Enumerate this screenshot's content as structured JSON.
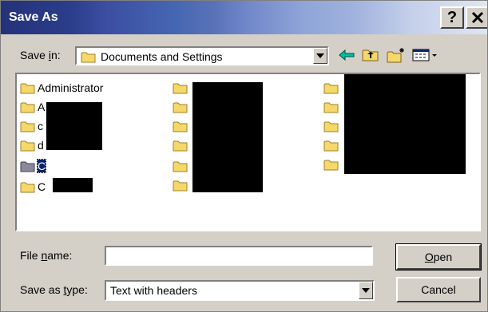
{
  "window": {
    "title": "Save As",
    "help_label": "?",
    "close_label": "✕"
  },
  "toolbar": {
    "save_in_prefix": "Save ",
    "save_in_underline": "i",
    "save_in_suffix": "n:",
    "location": "Documents and Settings",
    "tools": [
      "back-arrow-icon",
      "up-one-level-icon",
      "new-folder-icon",
      "view-menu-icon"
    ]
  },
  "files": {
    "items": [
      {
        "label": "Administrator"
      },
      {
        "label": "A"
      },
      {
        "label": "c"
      },
      {
        "label": "d"
      },
      {
        "label": "C"
      },
      {
        "label": "C"
      }
    ]
  },
  "file_name": {
    "prefix": "File ",
    "underline": "n",
    "suffix": "ame:",
    "value": ""
  },
  "save_type": {
    "prefix": "Save as ",
    "underline": "t",
    "suffix": "ype:",
    "value": "Text with headers"
  },
  "buttons": {
    "open_underline": "O",
    "open_rest": "pen",
    "cancel": "Cancel"
  }
}
